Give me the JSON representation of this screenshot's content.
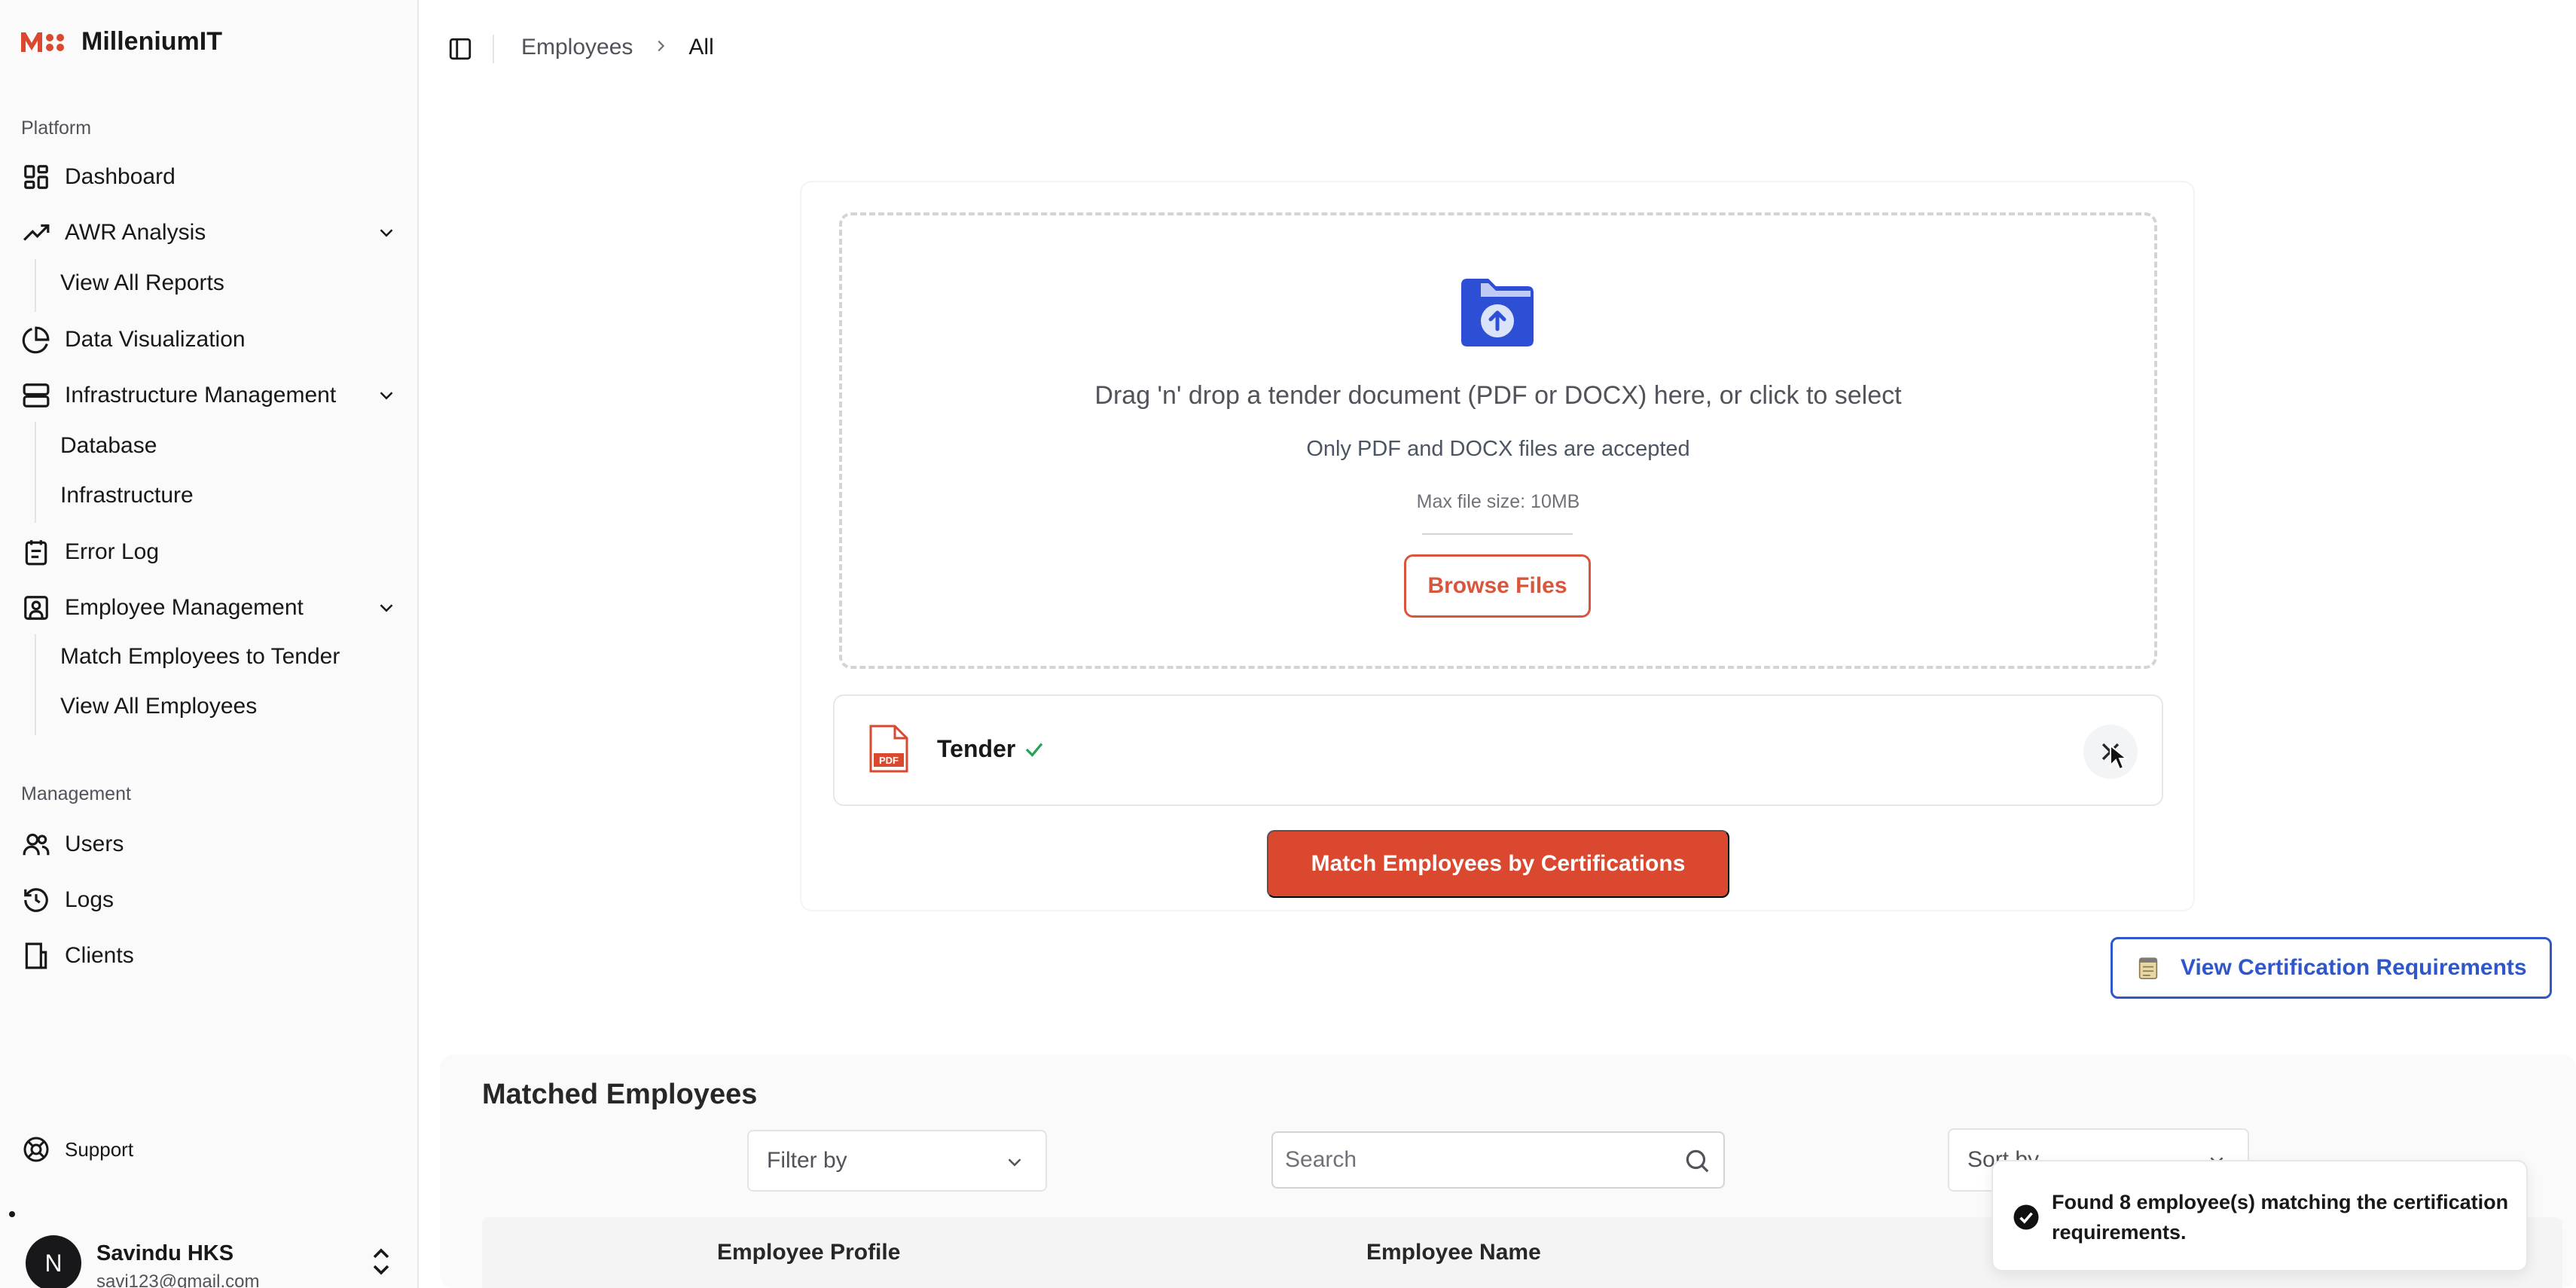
{
  "brand": {
    "name": "MilleniumIT"
  },
  "sidebar": {
    "platform_label": "Platform",
    "management_label": "Management",
    "items": {
      "dashboard": "Dashboard",
      "awr": "AWR Analysis",
      "awr_reports": "View All Reports",
      "data_viz": "Data Visualization",
      "infra_mgmt": "Infrastructure Management",
      "database": "Database",
      "infrastructure": "Infrastructure",
      "error_log": "Error Log",
      "employee_mgmt": "Employee Management",
      "match_employees": "Match Employees to Tender",
      "view_employees": "View All Employees",
      "users": "Users",
      "logs": "Logs",
      "clients": "Clients"
    },
    "support": "Support",
    "user": {
      "initial": "N",
      "name": "Savindu HKS",
      "email": "savi123@gmail.com"
    }
  },
  "header": {
    "breadcrumb_parent": "Employees",
    "breadcrumb_current": "All"
  },
  "upload": {
    "title": "Drag 'n' drop a tender document (PDF or DOCX) here, or click to select",
    "subtitle": "Only PDF and DOCX files are accepted",
    "max_size": "Max file size: 10MB",
    "browse_label": "Browse Files",
    "file_name": "Tender",
    "file_badge": "PDF"
  },
  "actions": {
    "match_label": "Match Employees by Certifications",
    "cert_label": "View Certification Requirements"
  },
  "results": {
    "title": "Matched Employees",
    "filter_label": "Filter by",
    "search_placeholder": "Search",
    "sort_label": "Sort by",
    "columns": [
      "Employee Profile",
      "Employee Name"
    ]
  },
  "toast": {
    "message": "Found 8 employee(s) matching the certification requirements."
  },
  "colors": {
    "accent": "#d9482f",
    "link_blue": "#2f57c9",
    "folder_blue": "#2d4fd6",
    "success": "#22a355"
  }
}
